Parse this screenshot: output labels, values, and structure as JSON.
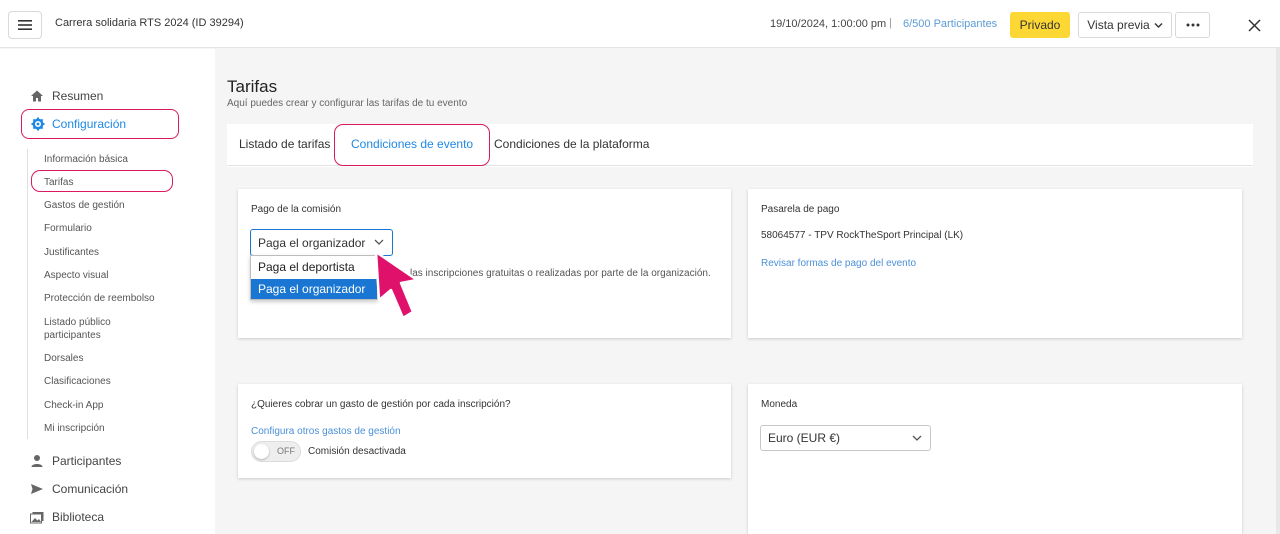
{
  "header": {
    "menu_icon": "hamburger-icon",
    "event_title": "Carrera solidaria RTS 2024 (ID 39294)",
    "datetime": "19/10/2024, 1:00:00 pm",
    "separator": "|",
    "participants_count": "6/500",
    "participants_label": "Participantes",
    "private_label": "Privado",
    "preview_label": "Vista previa",
    "more_label": "···",
    "close_icon": "close-icon",
    "colors": {
      "private_bg": "#fdd835",
      "link": "#5b9bd5"
    }
  },
  "sidebar": {
    "summary": "Resumen",
    "config": "Configuración",
    "sub_items": [
      "Información básica",
      "Tarifas",
      "Gastos de gestión",
      "Formulario",
      "Justificantes",
      "Aspecto visual",
      "Protección de reembolso",
      "Listado público participantes",
      "Dorsales",
      "Clasificaciones",
      "Check-in App",
      "Mi inscripción"
    ],
    "participants": "Participantes",
    "communication": "Comunicación",
    "library": "Biblioteca",
    "highlight_color": "#d81b60"
  },
  "main": {
    "title": "Tarifas",
    "subtitle": "Aquí puedes crear y configurar las tarifas de tu evento",
    "tabs": [
      "Listado de tarifas",
      "Condiciones de evento",
      "Condiciones de la plataforma"
    ],
    "active_tab": "Condiciones de evento"
  },
  "commission_card": {
    "title": "Pago de la comisión",
    "selected": "Paga el organizador",
    "options": [
      "Paga el deportista",
      "Paga el organizador"
    ],
    "note_fragment": "las inscripciones gratuitas o realizadas por parte de la organización."
  },
  "gateway_card": {
    "title": "Pasarela de pago",
    "value": "58064577 - TPV RockTheSport Principal (LK)",
    "link": "Revisar formas de pago del evento"
  },
  "fee_card": {
    "title": "¿Quieres cobrar un gasto de gestión por cada inscripción?",
    "link": "Configura otros gastos de gestión",
    "toggle_state": "OFF",
    "toggle_label": "Comisión desactivada"
  },
  "currency_card": {
    "title": "Moneda",
    "selected": "Euro (EUR €)"
  }
}
